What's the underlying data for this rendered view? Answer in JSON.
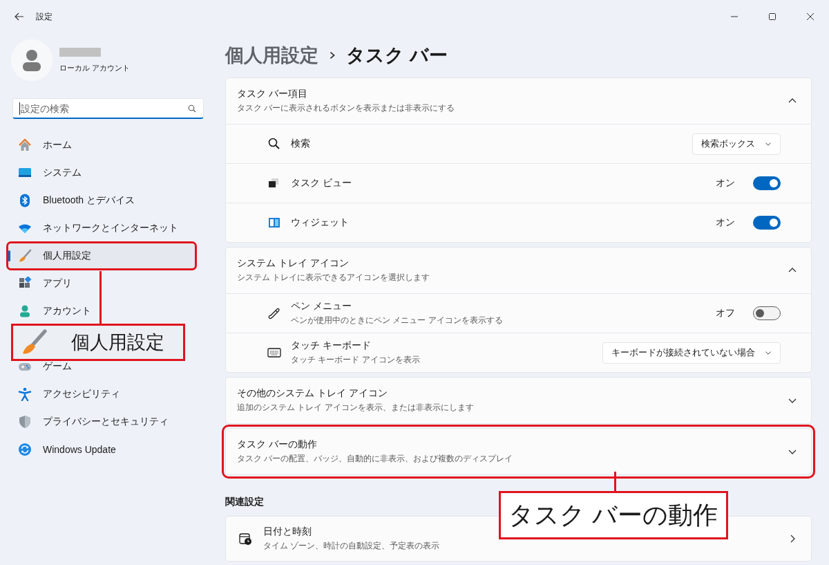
{
  "window": {
    "title": "設定"
  },
  "account": {
    "type": "ローカル アカウント"
  },
  "search": {
    "placeholder": "設定の検索"
  },
  "nav_groups": [
    [
      {
        "label": "ホーム",
        "selected": false,
        "annotated": false
      },
      {
        "label": "システム",
        "selected": false,
        "annotated": false
      },
      {
        "label": "Bluetooth とデバイス",
        "selected": false,
        "annotated": false
      },
      {
        "label": "ネットワークとインターネット",
        "selected": false,
        "annotated": false
      },
      {
        "label": "個人用設定",
        "selected": true,
        "annotated": true
      },
      {
        "label": "アプリ",
        "selected": false,
        "annotated": false
      },
      {
        "label": "アカウント",
        "selected": false,
        "annotated": false
      }
    ],
    [
      {
        "label": "ゲーム",
        "selected": false,
        "annotated": false
      },
      {
        "label": "アクセシビリティ",
        "selected": false,
        "annotated": false
      },
      {
        "label": "プライバシーとセキュリティ",
        "selected": false,
        "annotated": false
      },
      {
        "label": "Windows Update",
        "selected": false,
        "annotated": false
      }
    ]
  ],
  "breadcrumb": [
    "個人用設定",
    "タスク バー"
  ],
  "sections": [
    {
      "title": "タスク バー項目",
      "subtitle": "タスク バーに表示されるボタンを表示または非表示にする",
      "expanded": true,
      "annotated": false,
      "items": [
        {
          "kind": "dropdown",
          "label": "検索",
          "value": "検索ボックス"
        },
        {
          "kind": "toggle",
          "label": "タスク ビュー",
          "state_text": "オン",
          "on": true
        },
        {
          "kind": "toggle",
          "label": "ウィジェット",
          "state_text": "オン",
          "on": true
        }
      ]
    },
    {
      "title": "システム トレイ アイコン",
      "subtitle": "システム トレイに表示できるアイコンを選択します",
      "expanded": true,
      "annotated": false,
      "items": [
        {
          "kind": "toggle",
          "label": "ペン メニュー",
          "description": "ペンが使用中のときにペン メニュー アイコンを表示する",
          "state_text": "オフ",
          "on": false
        },
        {
          "kind": "dropdown",
          "label": "タッチ キーボード",
          "description": "タッチ キーボード アイコンを表示",
          "value": "キーボードが接続されていない場合"
        }
      ]
    },
    {
      "title": "その他のシステム トレイ アイコン",
      "subtitle": "追加のシステム トレイ アイコンを表示、または非表示にします",
      "expanded": false,
      "annotated": false
    },
    {
      "title": "タスク バーの動作",
      "subtitle": "タスク バーの配置、バッジ、自動的に非表示、および複数のディスプレイ",
      "expanded": false,
      "annotated": true
    }
  ],
  "related": {
    "heading": "関連設定",
    "items": [
      {
        "title": "日付と時刻",
        "subtitle": "タイム ゾーン、時計の自動設定、予定表の表示"
      }
    ]
  },
  "callouts": [
    {
      "text": "個人用設定"
    },
    {
      "text": "タスク バーの動作"
    }
  ]
}
